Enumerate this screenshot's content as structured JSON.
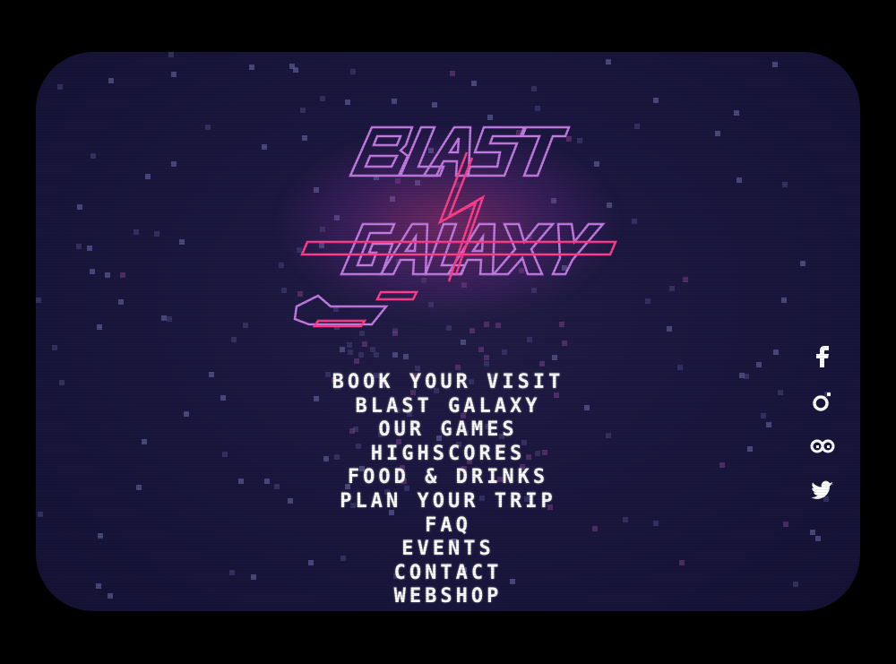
{
  "logo": {
    "alt": "BLAST GALAXY"
  },
  "menu": {
    "items": [
      {
        "label": "BOOK YOUR VISIT"
      },
      {
        "label": "BLAST GALAXY"
      },
      {
        "label": "OUR GAMES"
      },
      {
        "label": "HIGHSCORES"
      },
      {
        "label": "FOOD & DRINKS"
      },
      {
        "label": "PLAN YOUR TRIP"
      },
      {
        "label": "FAQ"
      },
      {
        "label": "EVENTS"
      },
      {
        "label": "CONTACT"
      },
      {
        "label": "WEBSHOP"
      }
    ]
  },
  "social": {
    "items": [
      {
        "icon": "facebook-icon"
      },
      {
        "icon": "instagram-icon"
      },
      {
        "icon": "tripadvisor-icon"
      },
      {
        "icon": "twitter-icon"
      }
    ]
  },
  "colors": {
    "page_bg": "#000000",
    "screen_bg": "#1b1740",
    "menu_text": "#ffffff",
    "logo_pink": "#ff3d8b",
    "logo_violet": "#b86bd9"
  }
}
